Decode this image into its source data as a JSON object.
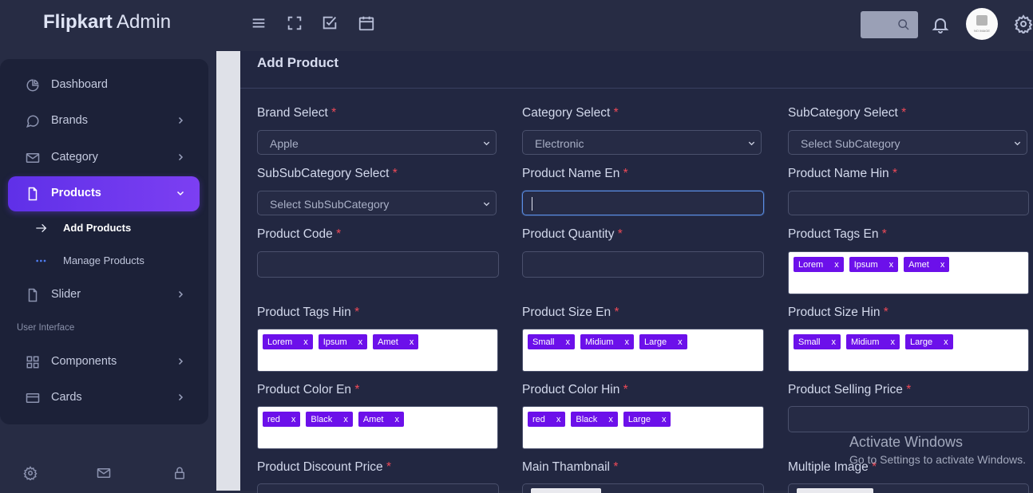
{
  "app": {
    "brand_strong": "Flipkart",
    "brand_rest": " Admin"
  },
  "header": {
    "icons": [
      "menu-icon",
      "fullscreen-icon",
      "checkbox-icon",
      "calendar-icon"
    ],
    "avatar_text": "NO IMAGE"
  },
  "sidebar": {
    "items": [
      {
        "label": "Dashboard",
        "icon": "pie-chart-icon"
      },
      {
        "label": "Brands",
        "icon": "chat-icon"
      },
      {
        "label": "Category",
        "icon": "mail-icon"
      },
      {
        "label": "Products",
        "icon": "file-icon"
      },
      {
        "label": "Slider",
        "icon": "file-icon"
      },
      {
        "label": "Components",
        "icon": "grid-icon"
      },
      {
        "label": "Cards",
        "icon": "card-icon"
      }
    ],
    "sub_items": [
      {
        "label": "Add Products"
      },
      {
        "label": "Manage Products"
      }
    ],
    "section_label": "User Interface"
  },
  "content": {
    "title": "Add Product",
    "required_mark": "*",
    "fields": {
      "brand": {
        "label": "Brand Select",
        "value": "Apple"
      },
      "category": {
        "label": "Category Select",
        "value": "Electronic"
      },
      "subcategory": {
        "label": "SubCategory Select",
        "value": "Select SubCategory"
      },
      "subsubcategory": {
        "label": "SubSubCategory Select",
        "value": "Select SubSubCategory"
      },
      "name_en": {
        "label": "Product Name En",
        "value": ""
      },
      "name_hin": {
        "label": "Product Name Hin",
        "value": ""
      },
      "code": {
        "label": "Product Code",
        "value": ""
      },
      "quantity": {
        "label": "Product Quantity",
        "value": ""
      },
      "tags_en": {
        "label": "Product Tags En",
        "tags": [
          "Lorem",
          "Ipsum",
          "Amet"
        ]
      },
      "tags_hin": {
        "label": "Product Tags Hin",
        "tags": [
          "Lorem",
          "Ipsum",
          "Amet"
        ]
      },
      "size_en": {
        "label": "Product Size En",
        "tags": [
          "Small",
          "Midium",
          "Large"
        ]
      },
      "size_hin": {
        "label": "Product Size Hin",
        "tags": [
          "Small",
          "Midium",
          "Large"
        ]
      },
      "color_en": {
        "label": "Product Color En",
        "tags": [
          "red",
          "Black",
          "Amet"
        ]
      },
      "color_hin": {
        "label": "Product Color Hin",
        "tags": [
          "red",
          "Black",
          "Large"
        ]
      },
      "selling_price": {
        "label": "Product Selling Price",
        "value": ""
      },
      "discount_price": {
        "label": "Product Discount Price"
      },
      "main_thumbnail": {
        "label": "Main Thambnail"
      },
      "multiple_image": {
        "label": "Multiple Image"
      }
    },
    "tag_remove": "x"
  },
  "watermark": {
    "line1": "Activate Windows",
    "line2": "Go to Settings to activate Windows."
  },
  "colors": {
    "accent": "#6c10ea",
    "active_gradient_start": "#5f30e8",
    "required": "#ef4a58",
    "background": "#272c44"
  }
}
